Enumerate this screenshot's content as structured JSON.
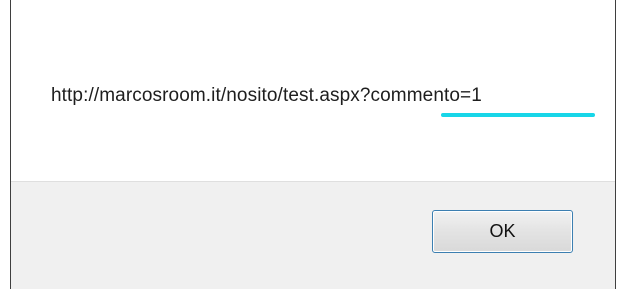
{
  "dialog": {
    "message": "http://marcosroom.it/nosito/test.aspx?commento=1",
    "highlight_color": "#17d6e8",
    "ok_label": "OK"
  }
}
